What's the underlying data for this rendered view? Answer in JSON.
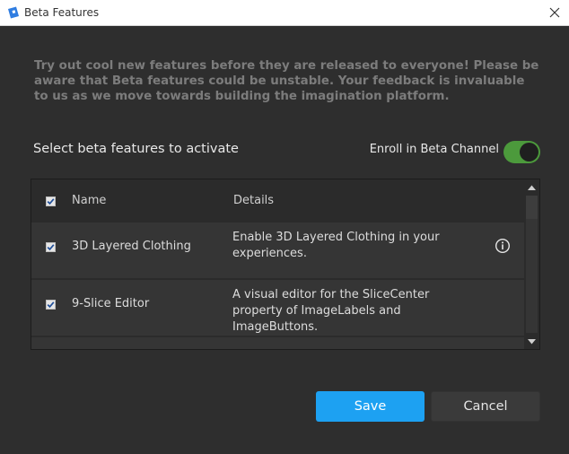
{
  "window": {
    "title": "Beta Features",
    "icon": "roblox-studio-icon",
    "close_icon": "close-icon"
  },
  "intro_text": "Try out cool new features before they are released to everyone! Please be aware that Beta features could be unstable. Your feedback is invaluable to us as we move towards building the imagination platform.",
  "section_label": "Select beta features to activate",
  "enroll": {
    "label": "Enroll in Beta Channel",
    "enabled": true,
    "accent": "#4c9a3c"
  },
  "table": {
    "columns": {
      "name": "Name",
      "details": "Details"
    },
    "select_all_checked": true,
    "rows": [
      {
        "checked": true,
        "name": "3D Layered Clothing",
        "details": "Enable 3D Layered Clothing in your experiences.",
        "info_icon": "info-icon"
      },
      {
        "checked": true,
        "name": "9-Slice Editor",
        "details": "A visual editor for the SliceCenter property of ImageLabels and ImageButtons."
      }
    ]
  },
  "buttons": {
    "save": "Save",
    "cancel": "Cancel",
    "save_color": "#1da1f2"
  }
}
